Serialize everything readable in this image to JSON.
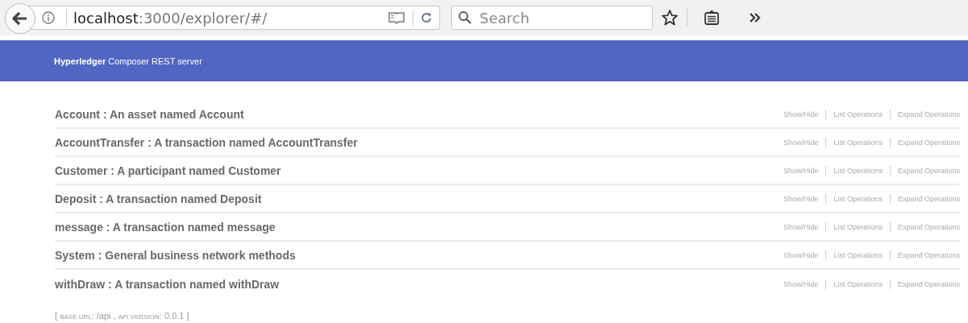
{
  "browser": {
    "url": {
      "host": "localhost",
      "path": ":3000/explorer/#/"
    },
    "search": {
      "placeholder": "Search"
    }
  },
  "header": {
    "title": "**Hyperledger** Composer REST server"
  },
  "resources": [
    {
      "title": "Account : An asset named Account",
      "links": [
        "Show/Hide",
        "List Operations",
        "Expand Operations"
      ]
    },
    {
      "title": "AccountTransfer : A transaction named AccountTransfer",
      "links": [
        "Show/Hide",
        "List Operations",
        "Expand Operations"
      ]
    },
    {
      "title": "Customer : A participant named Customer",
      "links": [
        "Show/Hide",
        "List Operations",
        "Expand Operations"
      ]
    },
    {
      "title": "Deposit : A transaction named Deposit",
      "links": [
        "Show/Hide",
        "List Operations",
        "Expand Operations"
      ]
    },
    {
      "title": "message : A transaction named message",
      "links": [
        "Show/Hide",
        "List Operations",
        "Expand Operations"
      ]
    },
    {
      "title": "System : General business network methods",
      "links": [
        "Show/Hide",
        "List Operations",
        "Expand Operations"
      ]
    },
    {
      "title": "withDraw : A transaction named withDraw",
      "links": [
        "Show/Hide",
        "List Operations",
        "Expand Operations"
      ]
    }
  ],
  "footer": [
    {
      "text": "[ ",
      "kind": "normal"
    },
    {
      "text": "BASE URL",
      "kind": "small"
    },
    {
      "text": ": /api , ",
      "kind": "normal"
    },
    {
      "text": "API VERSION",
      "kind": "small"
    },
    {
      "text": ": 0.0.1 ]",
      "kind": "normal"
    }
  ]
}
